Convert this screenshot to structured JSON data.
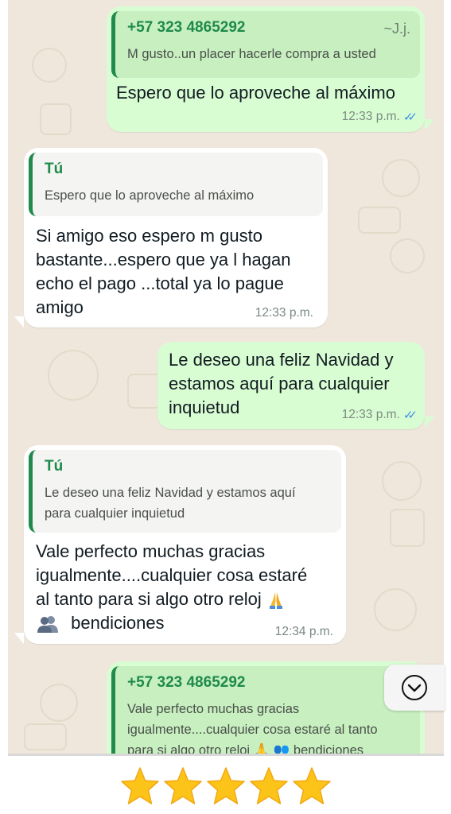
{
  "colors": {
    "outgoing_bubble": "#d9fdd3",
    "incoming_bubble": "#ffffff",
    "quote_bar": "#1f8a4c",
    "read_ticks": "#3d8fe8",
    "star": "#fcc419"
  },
  "messages": [
    {
      "direction": "outgoing",
      "quote": {
        "author": "+57 323 4865292",
        "alias": "~J.j.",
        "text": "M gusto..un placer hacerle compra a usted"
      },
      "text": "Espero que lo aproveche al máximo",
      "time": "12:33 p.m.",
      "status": "read"
    },
    {
      "direction": "incoming",
      "quote": {
        "author": "Tú",
        "text": "Espero que lo aproveche al máximo"
      },
      "text": "Si amigo eso espero m gusto\nbastante...espero que ya l hagan\necho el pago ...total ya lo pague\namigo",
      "time": "12:33 p.m."
    },
    {
      "direction": "outgoing",
      "text": "Le deseo una feliz Navidad y\nestamos aquí para cualquier\ninquietud",
      "time": "12:33 p.m.",
      "status": "read"
    },
    {
      "direction": "incoming",
      "quote": {
        "author": "Tú",
        "text": "Le deseo una feliz Navidad y estamos aquí\npara cualquier inquietud"
      },
      "text_lines": [
        "Vale perfecto muchas gracias",
        "igualmente....cualquier cosa estaré",
        "al tanto para si algo otro reloj"
      ],
      "emoji_1": "folded-hands-emoji",
      "text_end": "bendiciones",
      "emoji_2": "people-silhouette-emoji",
      "time": "12:34 p.m."
    },
    {
      "direction": "outgoing",
      "quote": {
        "author": "+57 323 4865292",
        "text": "Vale perfecto muchas gracias\nigualmente....cualquier cosa estaré al tanto\npara si algo otro reloj 🙏 👥 bendiciones"
      }
    }
  ],
  "scroll_button_icon": "chevron-down-icon",
  "rating": {
    "stars": 5,
    "max": 5
  }
}
